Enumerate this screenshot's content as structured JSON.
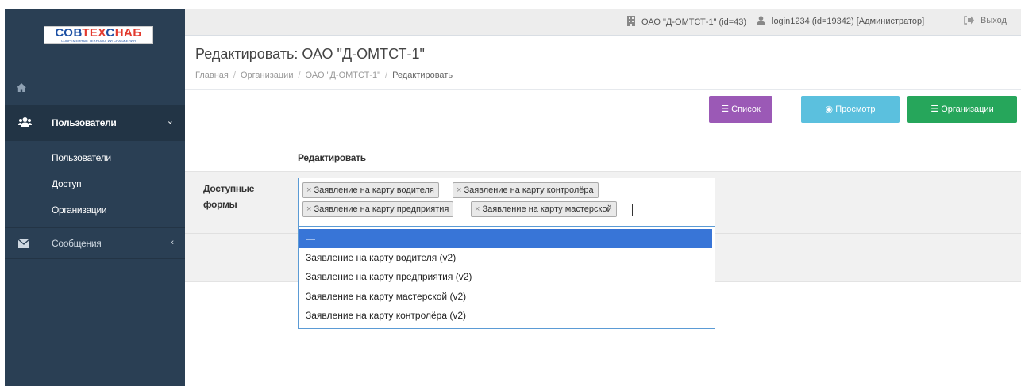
{
  "brand": {
    "name_part1": "СОВ",
    "name_part2": "ТЕХ",
    "name_part3": "С",
    "name_part4": "НАБ",
    "tagline": "СОВРЕМЕННЫЕ ТЕХНОЛОГИИ СНАБЖЕНИЯ"
  },
  "topbar": {
    "org": "ОАО \"Д-ОМТСТ-1\" (id=43)",
    "user": "login1234 (id=19342) [Администратор]",
    "exit": "Выход"
  },
  "sidebar": {
    "home_icon": "home-icon",
    "users_section": "Пользователи",
    "submenu": [
      "Пользователи",
      "Доступ",
      "Организации"
    ],
    "messages_section": "Сообщения"
  },
  "page": {
    "title": "Редактировать: ОАО \"Д-ОМТСТ-1\"",
    "breadcrumb": [
      "Главная",
      "Организации",
      "ОАО \"Д-ОМТСТ-1\"",
      "Редактировать"
    ]
  },
  "buttons": {
    "list": "Список",
    "view": "Просмотр",
    "orgs": "Организации"
  },
  "form": {
    "heading": "Редактировать",
    "field_label": "Доступные формы",
    "selected_tags": [
      "Заявление на карту водителя",
      "Заявление на карту контролёра",
      "Заявление на карту предприятия",
      "Заявление на карту мастерской"
    ],
    "dropdown_options": [
      "—",
      "Заявление на карту водителя (v2)",
      "Заявление на карту предприятия (v2)",
      "Заявление на карту мастерской (v2)",
      "Заявление на карту контролёра (v2)"
    ]
  },
  "colors": {
    "sidebar_bg": "#2a3f54",
    "btn_list": "#9b59b6",
    "btn_view": "#5bc0de",
    "btn_orgs": "#26a65b",
    "dropdown_highlight": "#3875d7"
  }
}
